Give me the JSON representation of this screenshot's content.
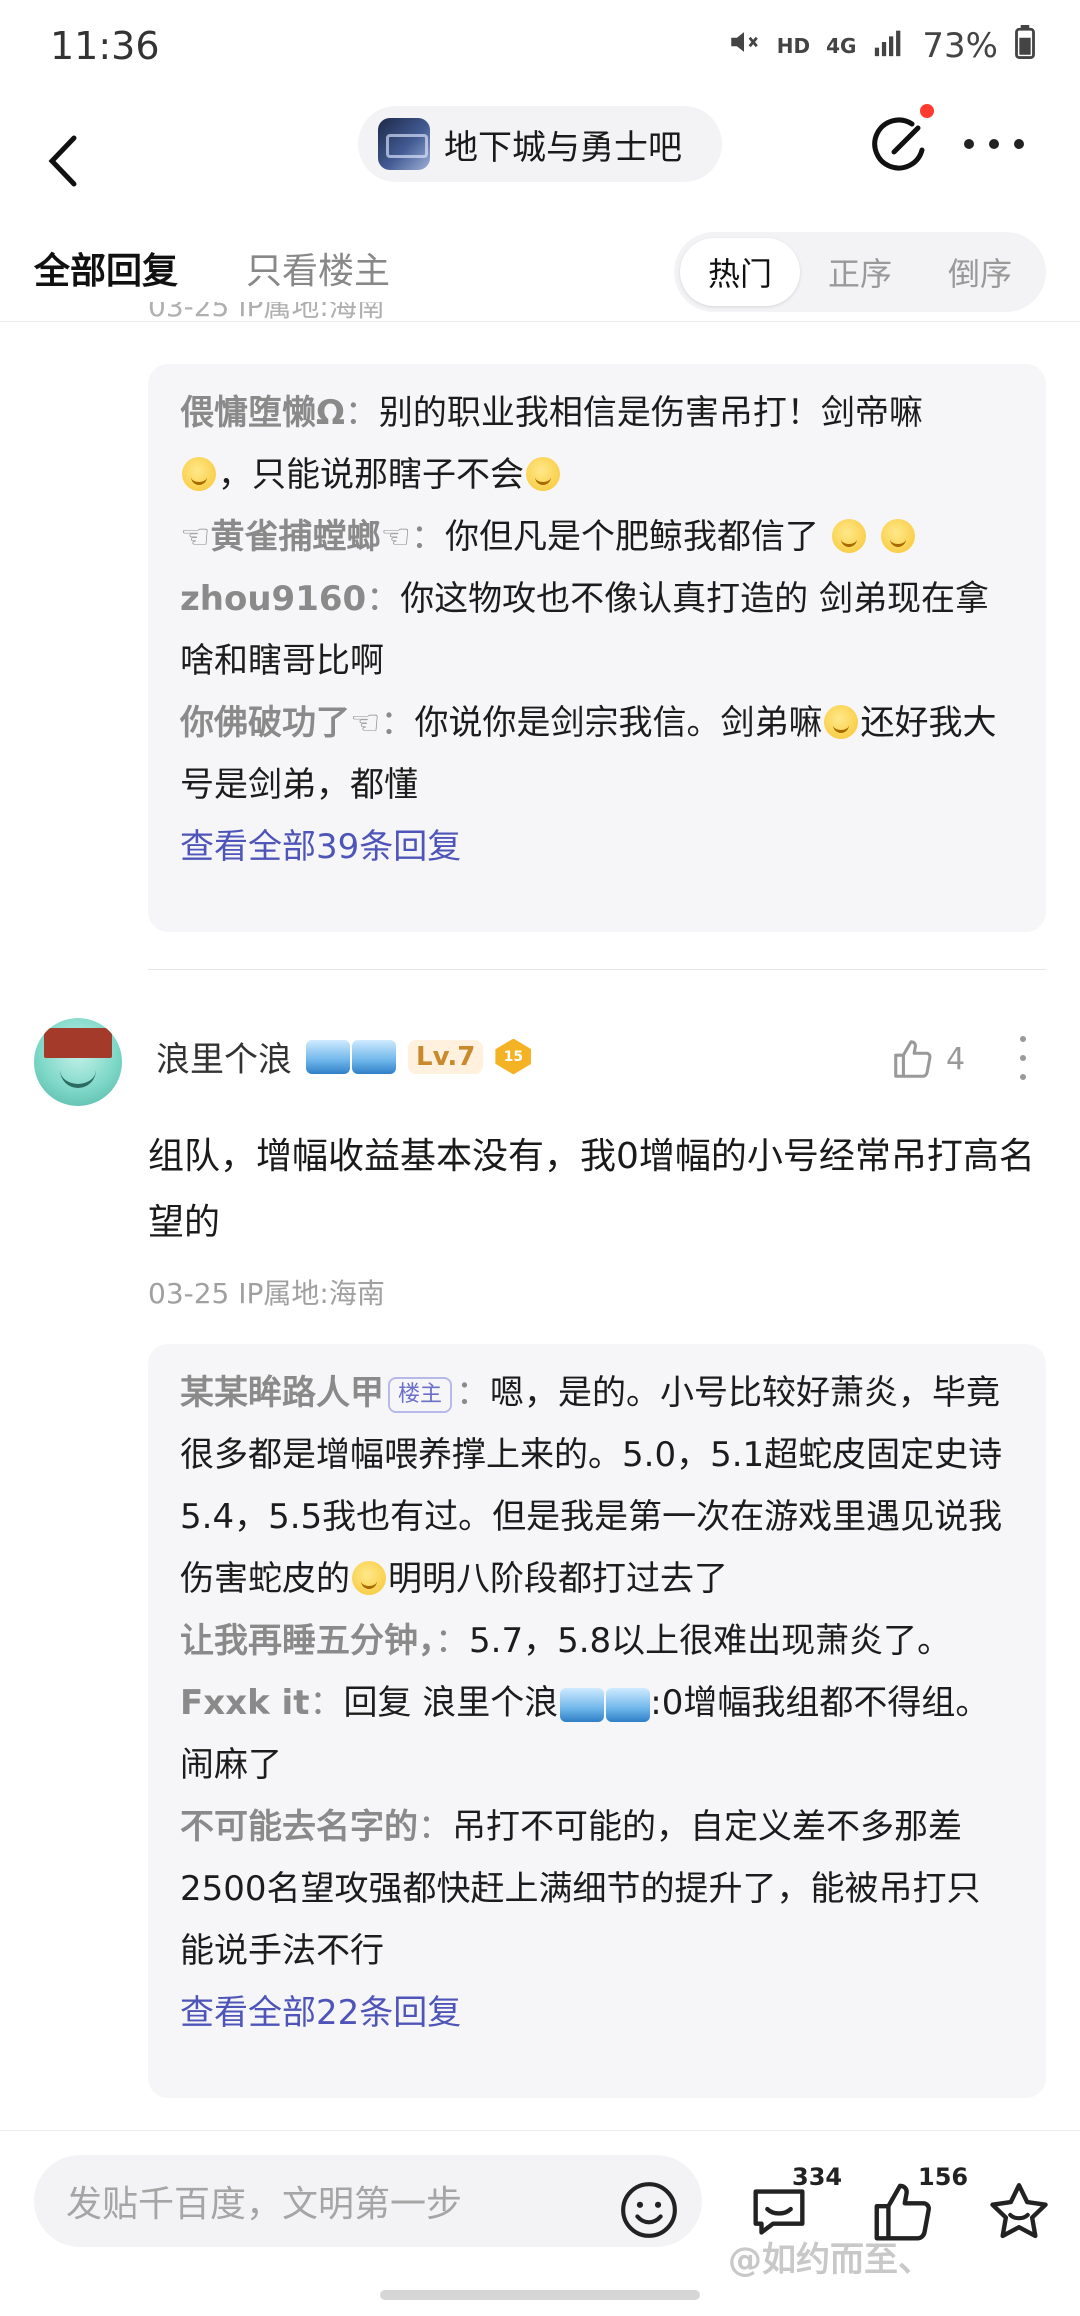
{
  "status_bar": {
    "time": "11:36",
    "net": "HD",
    "signal_type": "4G",
    "battery": "73%"
  },
  "nav": {
    "forum_name": "地下城与勇士吧"
  },
  "tabs": {
    "all": "全部回复",
    "op_only": "只看楼主",
    "sort": [
      "热门",
      "正序",
      "倒序"
    ],
    "active_sort": "热门"
  },
  "thread1": {
    "cutoff_text": "03-25 IP属地:海南",
    "replies": [
      {
        "author": "偎慵堕懒Ω",
        "text_a": "别的职业我相信是伤害吊打！剑帝嘛",
        "text_b": "，只能说那瞎子不会"
      },
      {
        "author": "☜黄雀捕螳螂☜",
        "text_a": "你但凡是个肥鲸我都信了"
      },
      {
        "author": "zhou9160",
        "text_a": "你这物攻也不像认真打造的 剑弟现在拿啥和瞎哥比啊"
      },
      {
        "author": "你佛破功了☜",
        "text_a": "你说你是剑宗我信。剑弟嘛",
        "text_b": "还好我大号是剑弟，都懂"
      }
    ],
    "view_all": "查看全部39条回复"
  },
  "post": {
    "username": "浪里个浪",
    "level": "Lv.7",
    "badge": "15",
    "likes": "4",
    "body": "组队，增幅收益基本没有，我0增幅的小号经常吊打高名望的",
    "meta": "03-25  IP属地:海南"
  },
  "thread2": {
    "op_tag": "楼主",
    "replies": [
      {
        "author": "某某眸路人甲",
        "text_a": "嗯，是的。小号比较好萧炎，毕竟很多都是增幅喂养撑上来的。5.0，5.1超蛇皮固定史诗5.4，5.5我也有过。但是我是第一次在游戏里遇见说我伤害蛇皮的",
        "text_b": "明明八阶段都打过去了"
      },
      {
        "author": "让我再睡五分钟，",
        "text_a": "5.7，5.8以上很难出现萧炎了。"
      },
      {
        "author": "Fxxk it",
        "text_a": "回复 浪里个浪",
        "text_b": ":0增幅我组都不得组。闹麻了"
      },
      {
        "author": "不可能去名字的",
        "text_a": "吊打不可能的，自定义差不多那差2500名望攻强都快赶上满细节的提升了，能被吊打只能说手法不行"
      }
    ],
    "view_all": "查看全部22条回复"
  },
  "bottom": {
    "input_placeholder": "发贴千百度，文明第一步",
    "comments": "334",
    "likes": "156",
    "watermark": "@如约而至、"
  }
}
